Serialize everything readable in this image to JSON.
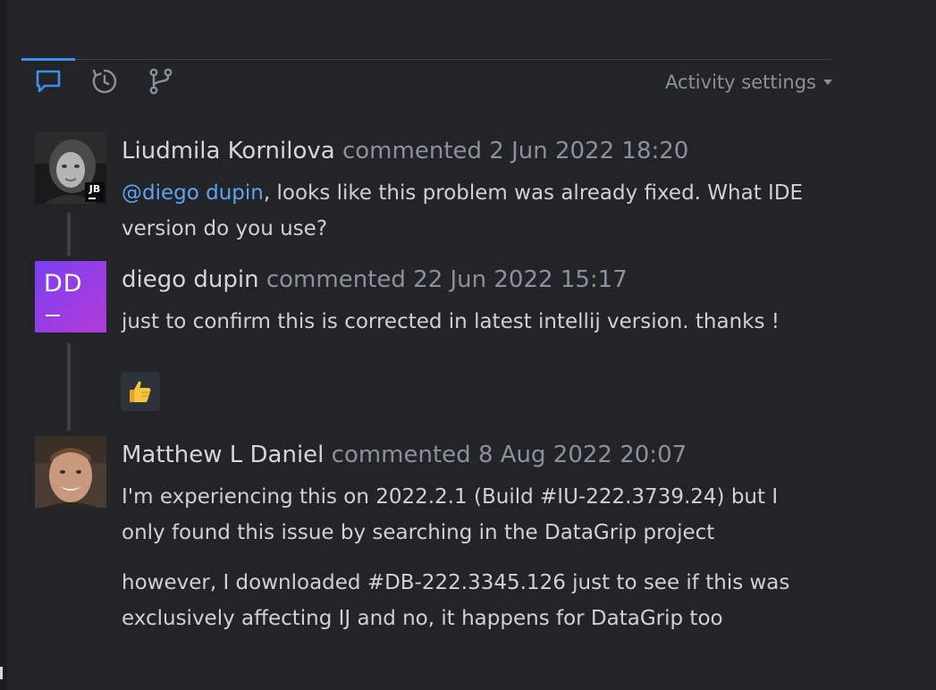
{
  "activity_settings": {
    "label": "Activity settings"
  },
  "comments": [
    {
      "author": "Liudmila Kornilova",
      "verb": "commented",
      "date": "2 Jun 2022 18:20",
      "badge": "JB",
      "mention": "@diego dupin",
      "text_after_mention": ", looks like this problem was already fixed. What IDE version do you use?"
    },
    {
      "author": "diego dupin",
      "verb": "commented",
      "date": "22 Jun 2022 15:17",
      "initials": "DD",
      "text": "just to confirm this is corrected in latest intellij version. thanks !",
      "reaction": "👍"
    },
    {
      "author": "Matthew L Daniel",
      "verb": "commented",
      "date": "8 Aug 2022 20:07",
      "paragraph1": "I'm experiencing this on 2022.2.1 (Build #IU-222.3739.24) but I only found this issue by searching in the DataGrip project",
      "paragraph2": "however, I downloaded #DB-222.3345.126 just to see if this was exclusively affecting IJ and no, it happens for DataGrip too"
    }
  ],
  "colors": {
    "background": "#222428",
    "accent": "#3f8ef0",
    "mention": "#5fa3f2",
    "muted": "#8b919c",
    "avatar_dd_gradient": [
      "#7b3ff0",
      "#b33bd8"
    ]
  }
}
